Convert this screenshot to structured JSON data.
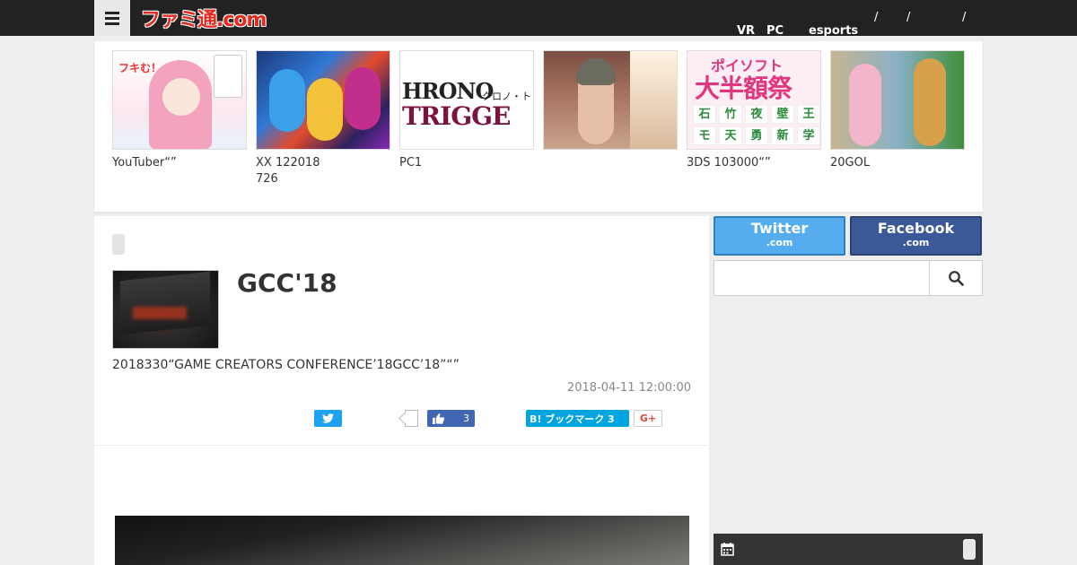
{
  "header": {
    "logo_text": "ファミ通.com",
    "nav": [
      {
        "label": "VR"
      },
      {
        "label": "PC"
      },
      {
        "label": "esports"
      }
    ],
    "separators": [
      "/",
      "/",
      "/"
    ]
  },
  "recommended": [
    {
      "caption": "YouTuber“”"
    },
    {
      "caption": "XX  122018\n726"
    },
    {
      "caption": "PC1"
    },
    {
      "caption": ""
    },
    {
      "caption": "3DS 103000“”"
    },
    {
      "caption": "20GOL"
    }
  ],
  "thumbs": {
    "t1_text": "フキむ！",
    "t3_line1": "HRONO",
    "t3_line2": "TRIGGE",
    "t3_jp": "クロノ・ト",
    "t5_top": "ポイソフト",
    "t5_mid": "大半額祭",
    "t5_grid": [
      "石",
      "竹",
      "夜",
      "壁",
      "王",
      "モ",
      "天",
      "勇",
      "新",
      "学"
    ]
  },
  "article": {
    "title": "GCC'18",
    "lead": "2018330“GAME CREATORS CONFERENCE’18GCC’18”“”",
    "date": "2018-04-11 12:00:00",
    "fb_like_count": "3",
    "hatena_label": "B! ブックマーク 3",
    "gplus_label": "G+"
  },
  "sidebar": {
    "twitter_label": "Twitter",
    "twitter_sub": ".com",
    "facebook_label": "Facebook",
    "facebook_sub": ".com",
    "search_placeholder": ""
  },
  "colors": {
    "topbar": "#222222",
    "logo_red": "#e6281e",
    "twitter_blue": "#55acee",
    "facebook_blue": "#3b5998",
    "hatena_blue": "#00a4de"
  }
}
